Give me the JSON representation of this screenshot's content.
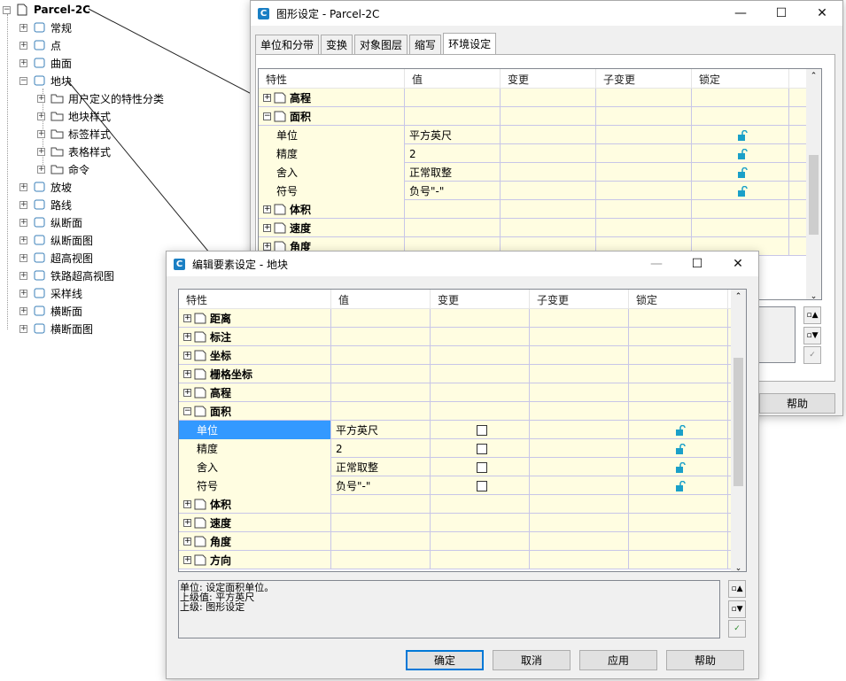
{
  "tree": {
    "root": "Parcel-2C",
    "items": [
      {
        "label": "常规",
        "icon": "gear-icon"
      },
      {
        "label": "点",
        "icon": "point-icon"
      },
      {
        "label": "曲面",
        "icon": "surface-icon"
      },
      {
        "label": "地块",
        "icon": "parcel-icon"
      },
      {
        "label": "用户定义的特性分类",
        "icon": "folder-icon"
      },
      {
        "label": "地块样式",
        "icon": "folder-icon"
      },
      {
        "label": "标签样式",
        "icon": "folder-icon"
      },
      {
        "label": "表格样式",
        "icon": "folder-icon"
      },
      {
        "label": "命令",
        "icon": "folder-icon"
      },
      {
        "label": "放坡",
        "icon": "grading-icon"
      },
      {
        "label": "路线",
        "icon": "alignment-icon"
      },
      {
        "label": "纵断面",
        "icon": "profile-icon"
      },
      {
        "label": "纵断面图",
        "icon": "profile-view-icon"
      },
      {
        "label": "超高视图",
        "icon": "superelevation-icon"
      },
      {
        "label": "铁路超高视图",
        "icon": "rail-superelevation-icon"
      },
      {
        "label": "采样线",
        "icon": "sample-line-icon"
      },
      {
        "label": "横断面",
        "icon": "section-icon"
      },
      {
        "label": "横断面图",
        "icon": "section-view-icon"
      }
    ]
  },
  "back": {
    "title": "图形设定 - Parcel-2C",
    "tabs": [
      "单位和分带",
      "变换",
      "对象图层",
      "缩写",
      "环境设定"
    ],
    "headers": [
      "特性",
      "值",
      "变更",
      "子变更",
      "锁定"
    ],
    "rows": [
      {
        "name": "高程",
        "cat": true,
        "exp": "+"
      },
      {
        "name": "面积",
        "cat": true,
        "exp": "−"
      },
      {
        "name": "单位",
        "value": "平方英尺"
      },
      {
        "name": "精度",
        "value": "2"
      },
      {
        "name": "舍入",
        "value": "正常取整"
      },
      {
        "name": "符号",
        "value": "负号\"-\""
      },
      {
        "name": "体积",
        "cat": true,
        "exp": "+"
      },
      {
        "name": "速度",
        "cat": true,
        "exp": "+"
      },
      {
        "name": "角度",
        "cat": true,
        "exp": "+"
      }
    ],
    "help": "帮助"
  },
  "front": {
    "title": "编辑要素设定 - 地块",
    "headers": [
      "特性",
      "值",
      "变更",
      "子变更",
      "锁定"
    ],
    "rows": [
      {
        "name": "距离",
        "cat": true,
        "exp": "+"
      },
      {
        "name": "标注",
        "cat": true,
        "exp": "+"
      },
      {
        "name": "坐标",
        "cat": true,
        "exp": "+"
      },
      {
        "name": "栅格坐标",
        "cat": true,
        "exp": "+"
      },
      {
        "name": "高程",
        "cat": true,
        "exp": "+"
      },
      {
        "name": "面积",
        "cat": true,
        "exp": "−"
      },
      {
        "name": "单位",
        "value": "平方英尺",
        "sel": true
      },
      {
        "name": "精度",
        "value": "2"
      },
      {
        "name": "舍入",
        "value": "正常取整"
      },
      {
        "name": "符号",
        "value": "负号\"-\""
      },
      {
        "name": "体积",
        "cat": true,
        "exp": "+"
      },
      {
        "name": "速度",
        "cat": true,
        "exp": "+"
      },
      {
        "name": "角度",
        "cat": true,
        "exp": "+"
      },
      {
        "name": "方向",
        "cat": true,
        "exp": "+"
      }
    ],
    "desc": [
      "单位: 设定面积单位。",
      "上级值: 平方英尺",
      "上级: 图形设定"
    ],
    "buttons": {
      "ok": "确定",
      "cancel": "取消",
      "apply": "应用",
      "help": "帮助"
    }
  },
  "colors": {
    "grid_row": "#fffde1",
    "grid_line": "#c8c6e8",
    "select": "#3399ff",
    "accent": "#1a7fc4",
    "lock": "#1aa0c8"
  }
}
